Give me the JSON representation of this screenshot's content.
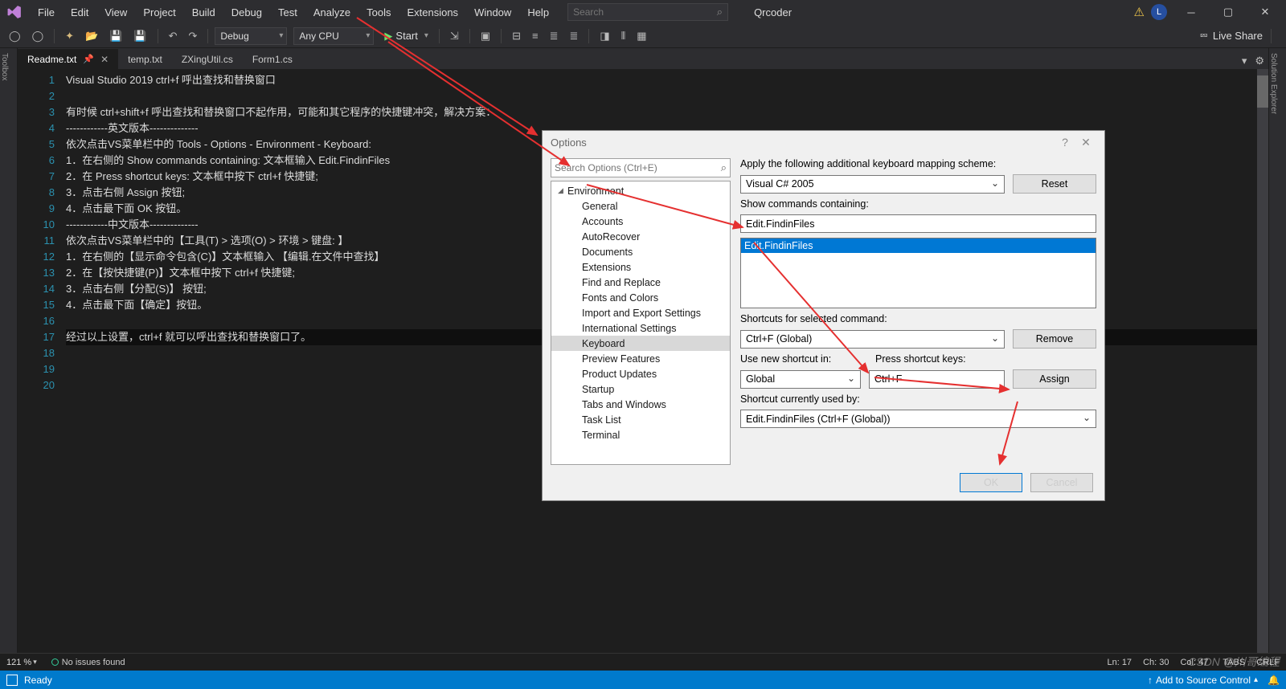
{
  "menubar": {
    "items": [
      "File",
      "Edit",
      "View",
      "Project",
      "Build",
      "Debug",
      "Test",
      "Analyze",
      "Tools",
      "Extensions",
      "Window",
      "Help"
    ],
    "search_placeholder": "Search",
    "project_name": "Qrcoder",
    "user_initial": "L"
  },
  "toolbar": {
    "config": "Debug",
    "platform": "Any CPU",
    "start": "Start",
    "live_share": "Live Share"
  },
  "tabs": [
    {
      "label": "Readme.txt",
      "active": true,
      "pinned": true,
      "close": true
    },
    {
      "label": "temp.txt",
      "active": false
    },
    {
      "label": "ZXingUtil.cs",
      "active": false
    },
    {
      "label": "Form1.cs",
      "active": false
    }
  ],
  "sidebars": {
    "left": "Toolbox",
    "right": "Solution Explorer"
  },
  "editor": {
    "lines": [
      "Visual Studio 2019 ctrl+f 呼出查找和替换窗口",
      "",
      "有时候 ctrl+shift+f 呼出查找和替换窗口不起作用，可能和其它程序的快捷键冲突，解决方案：",
      "------------英文版本--------------",
      "依次点击VS菜单栏中的 Tools - Options - Environment - Keyboard:",
      "1．在右侧的 Show commands containing: 文本框输入 Edit.FindinFiles",
      "2．在 Press shortcut keys: 文本框中按下 ctrl+f 快捷键;",
      "3．点击右侧 Assign 按钮;",
      "4．点击最下面 OK 按钮。",
      "------------中文版本--------------",
      "依次点击VS菜单栏中的【工具(T) > 选项(O) > 环境 > 键盘: 】",
      "1．在右侧的【显示命令包含(C)】文本框输入 【编辑.在文件中查找】",
      "2．在【按快捷键(P)】文本框中按下 ctrl+f 快捷键;",
      "3．点击右侧【分配(S)】 按钮;",
      "4．点击最下面【确定】按钮。",
      "",
      "经过以上设置，ctrl+f 就可以呼出查找和替换窗口了。",
      "",
      "",
      ""
    ],
    "cursor_line": 17
  },
  "bottom": {
    "zoom": "121 %",
    "issues": "No issues found",
    "ln": "Ln: 17",
    "ch": "Ch: 30",
    "col": "Col: 47",
    "tabs": "TABS",
    "crlf": "CRLF"
  },
  "status": {
    "ready": "Ready",
    "add_source": "Add to Source Control"
  },
  "dialog": {
    "title": "Options",
    "search_placeholder": "Search Options (Ctrl+E)",
    "tree_root": "Environment",
    "tree_children": [
      "General",
      "Accounts",
      "AutoRecover",
      "Documents",
      "Extensions",
      "Find and Replace",
      "Fonts and Colors",
      "Import and Export Settings",
      "International Settings",
      "Keyboard",
      "Preview Features",
      "Product Updates",
      "Startup",
      "Tabs and Windows",
      "Task List",
      "Terminal"
    ],
    "tree_selected": "Keyboard",
    "mapping_label": "Apply the following additional keyboard mapping scheme:",
    "mapping_value": "Visual C# 2005",
    "reset": "Reset",
    "show_commands_label": "Show commands containing:",
    "show_commands_value": "Edit.FindinFiles",
    "command_list_selected": "Edit.FindinFiles",
    "shortcuts_label": "Shortcuts for selected command:",
    "shortcuts_value": "Ctrl+F (Global)",
    "remove": "Remove",
    "use_new_label": "Use new shortcut in:",
    "use_new_value": "Global",
    "press_keys_label": "Press shortcut keys:",
    "press_keys_value": "Ctrl+F",
    "assign": "Assign",
    "used_by_label": "Shortcut currently used by:",
    "used_by_value": "Edit.FindinFiles (Ctrl+F (Global))",
    "ok": "OK",
    "cancel": "Cancel"
  },
  "watermark": "CSDN @川哥编程"
}
